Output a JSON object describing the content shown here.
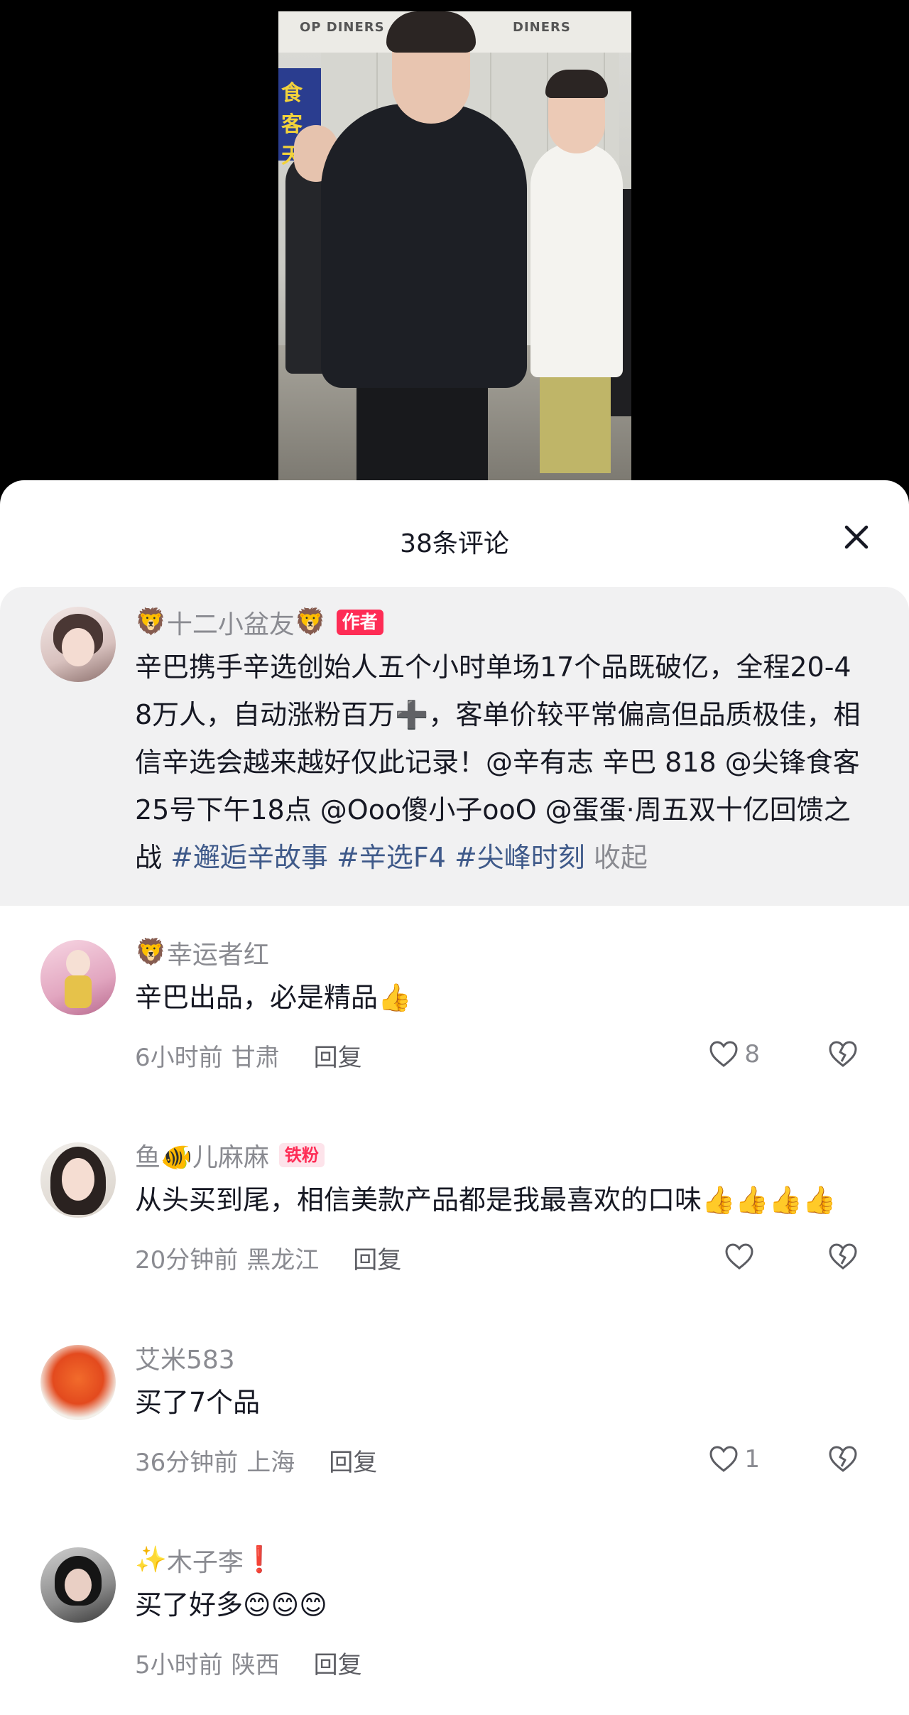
{
  "video": {
    "banner_left": "OP DINERS",
    "banner_right": "DINERS",
    "poster_text": "食客天"
  },
  "sheet": {
    "title": "38条评论",
    "close_icon": "close-icon"
  },
  "comments": [
    {
      "name_prefix_emoji": "🦁",
      "name": "十二小盆友",
      "name_suffix_emoji": "🦁",
      "badge": "作者",
      "text": "辛巴携手辛选创始人五个小时单场17个品既破亿，全程20-48万人，自动涨粉百万➕，客单价较平常偏高但品质极佳，相信辛选会越来越好仅此记录！@辛有志 辛巴 818 @尖锋食客 25号下午18点 @Ooo傻小子ooO @蛋蛋·周五双十亿回馈之战 ",
      "hashtags": "#邂逅辛故事 #辛选F4 #尖峰时刻",
      "collapse": "收起"
    },
    {
      "name_prefix_emoji": "🦁",
      "name": "幸运者红",
      "text": "辛巴出品，必是精品👍",
      "time": "6小时前",
      "location": "甘肃",
      "reply": "回复",
      "likes": "8"
    },
    {
      "name": "鱼🐠儿麻麻",
      "badge": "铁粉",
      "text": "从头买到尾，相信美款产品都是我最喜欢的口味👍👍👍👍",
      "time": "20分钟前",
      "location": "黑龙江",
      "reply": "回复",
      "likes": ""
    },
    {
      "name": "艾米583",
      "text": "买了7个品",
      "time": "36分钟前",
      "location": "上海",
      "reply": "回复",
      "likes": "1"
    },
    {
      "name_prefix_emoji": "✨",
      "name": "木子李",
      "name_suffix_emoji": "❗",
      "text": "买了好多😊😊😊",
      "time": "5小时前",
      "location": "陕西",
      "reply": "回复",
      "likes": ""
    }
  ]
}
